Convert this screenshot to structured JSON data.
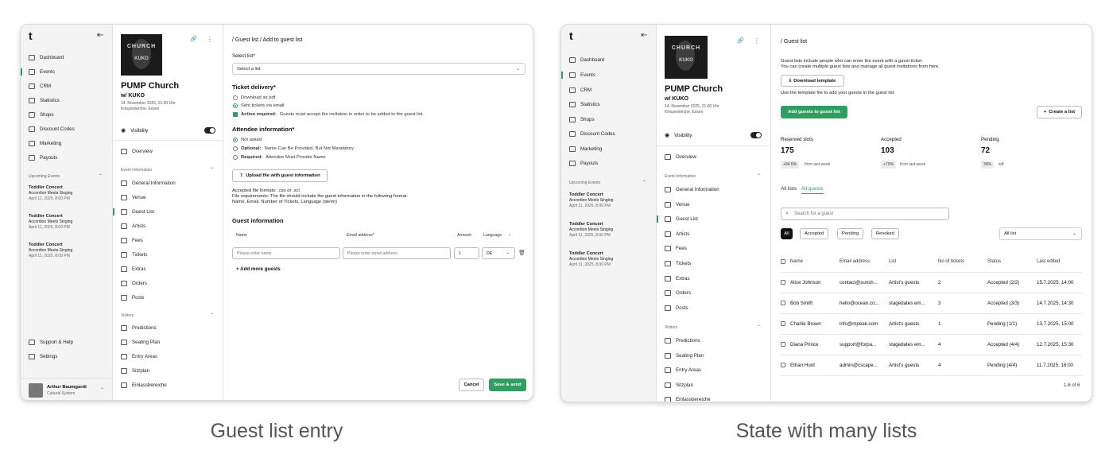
{
  "captions": {
    "left": "Guest list entry",
    "right": "State with many lists"
  },
  "nav": {
    "logo": "t",
    "items": [
      "Dashboard",
      "Events",
      "CRM",
      "Statistics",
      "Shops",
      "Discount Codes",
      "Marketing",
      "Payouts"
    ],
    "upcoming_label": "Upcoming Events",
    "upcoming": [
      {
        "title": "Toddler Concert",
        "sub": "Accordion Meets Singing",
        "date": "April 11, 2025, 8:00 PM"
      },
      {
        "title": "Toddler Concert",
        "sub": "Accordion Meets Singing",
        "date": "April 11, 2025, 8:00 PM"
      },
      {
        "title": "Toddler Concert",
        "sub": "Accordion Meets Singing",
        "date": "April 11, 2025, 8:00 PM"
      }
    ],
    "support": "Support & Help",
    "settings": "Settings",
    "user": {
      "name": "Arthur Baumgardt",
      "org": "Cultural System"
    }
  },
  "event": {
    "poster_line1": "CHURCH",
    "poster_line2": "KUKO",
    "title": "PUMP Church",
    "subtitle": "w/ KUKO",
    "date": "14. November 2025, 21:00 Uhr",
    "venue": "Kreuzeskirche, Essen",
    "visibility": "Visibility",
    "overview": "Overview",
    "info_section": "Event Information",
    "info_items": [
      "General Information",
      "Venue",
      "Guest List",
      "Artists",
      "Fees",
      "Tickets",
      "Extras",
      "Orders",
      "Posts"
    ],
    "visitors_section": "Visitors",
    "visitor_items": [
      "Predictions",
      "Seating Plan",
      "Entry Areas",
      "Sitzplan",
      "Einlassbereiche"
    ]
  },
  "entry": {
    "breadcrumb": "/ Guest list / Add to guest list",
    "select_label": "Select list*",
    "select_value": "Select a list",
    "delivery_title": "Ticket delivery*",
    "delivery_options": [
      "Download as pdf",
      "Sent tickets via email"
    ],
    "action_required_label": "Action required:",
    "action_required_text": "Guests must accept the invitation in order to be added to the guest list.",
    "attendee_title": "Attendee information*",
    "attendee_not_asked": "Not asked",
    "attendee_optional_label": "Optional:",
    "attendee_optional_text": "Name Can Be Provided, But Not Mandatory",
    "attendee_required_label": "Required:",
    "attendee_required_text": "Attendee Must Provide Name",
    "upload_button": "Upload file with guest information",
    "file_formats": "Accepted file formats: .csv or .xcl",
    "file_req": "File requirements: The file should include the guest information in the following format:",
    "file_cols": "Name, Email, Number of Tickets, Language (de/en)",
    "guest_title": "Guest information",
    "col_name": "Name",
    "col_email": "Email address*",
    "col_amount": "Amount",
    "col_language": "Language",
    "name_placeholder": "Please enter name",
    "email_placeholder": "Please enter email address",
    "amount_value": "1",
    "language_value": "DE",
    "add_more": "Add more guests",
    "cancel": "Cancel",
    "save": "Save & send"
  },
  "lists": {
    "breadcrumb": "/ Guest list",
    "intro1": "Guest lists include people who can enter the event with a guest ticket.",
    "intro2": "You can create multiple guest lists and manage all guest invitations from here.",
    "download_template": "Download template",
    "template_hint": "Use the template file to add your guests in the guest list",
    "add_guests": "Add guests to guest list",
    "create_list": "Create a list",
    "stats": [
      {
        "label": "Reserved slots",
        "value": "175",
        "chip": "+94.5%",
        "note": "from last week"
      },
      {
        "label": "Accepted",
        "value": "103",
        "chip": "+70%",
        "note": "from last week"
      },
      {
        "label": "Pending",
        "value": "72",
        "chip": "34%",
        "note": "left"
      }
    ],
    "tabs": [
      "All lists",
      "All guests"
    ],
    "search_placeholder": "Search for a guest",
    "filters": [
      "All",
      "Accepted",
      "Pending",
      "Revoked"
    ],
    "list_select": "All list",
    "columns": [
      "Name",
      "Email address",
      "List",
      "No of tickets",
      "Status",
      "Last edited"
    ],
    "rows": [
      {
        "name": "Alice Johnson",
        "email": "contact@sunsh...",
        "list": "Artist's guests",
        "tickets": "2",
        "status": "Accepted (2/2)",
        "edited": "15.7.2025, 14:00"
      },
      {
        "name": "Bob Smith",
        "email": "hello@ocean.co...",
        "list": "stagedates em...",
        "tickets": "3",
        "status": "Accepted (3/3)",
        "edited": "14.7.2025, 14:30"
      },
      {
        "name": "Charlie Brown",
        "email": "info@mpeak.com",
        "list": "Artist's guests",
        "tickets": "1",
        "status": "Pending (1/1)",
        "edited": "13.7.2025, 15:00"
      },
      {
        "name": "Diana Prince",
        "email": "support@forpa...",
        "list": "stagedates em...",
        "tickets": "4",
        "status": "Accepted (4/4)",
        "edited": "12.7.2025, 15:30"
      },
      {
        "name": "Ethan Hunt",
        "email": "admin@cscape...",
        "list": "Artist's guests",
        "tickets": "4",
        "status": "Pending (4/4)",
        "edited": "11.7.2025, 16:00"
      }
    ],
    "pager": "1-6 of 6"
  },
  "colors": {
    "accent": "#2f9e61",
    "dark": "#111111"
  }
}
